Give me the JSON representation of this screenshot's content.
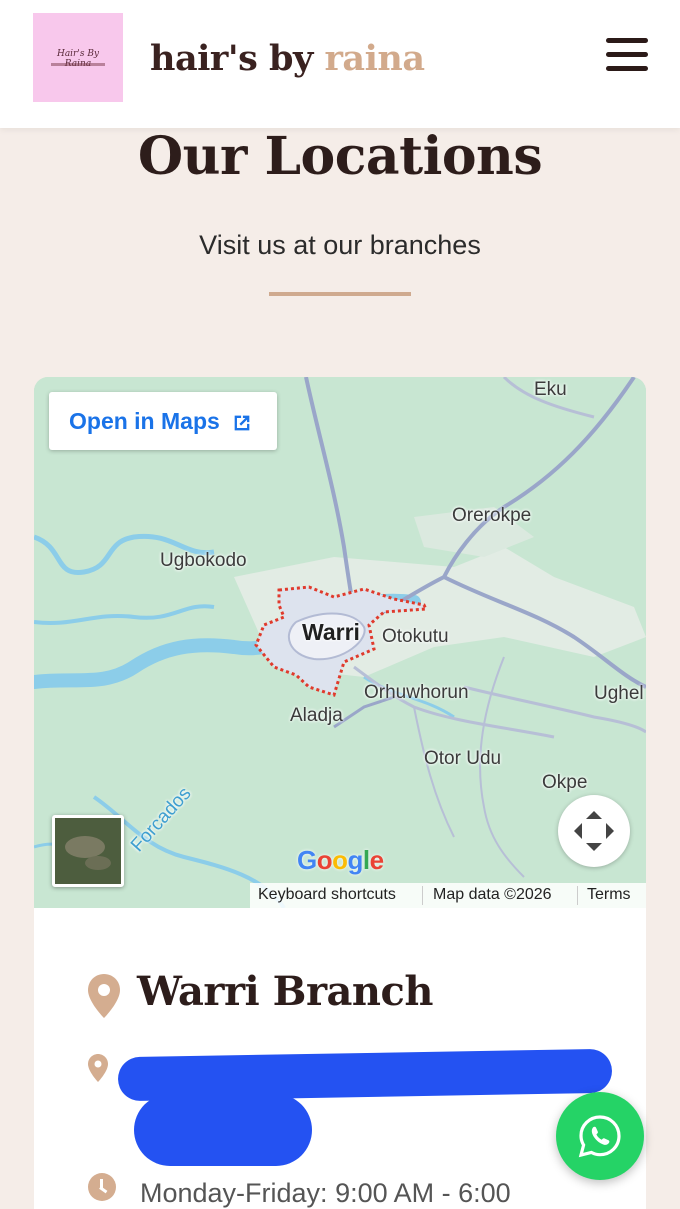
{
  "header": {
    "logo_text": "Hair's By Raina",
    "brand_primary": "hair's by",
    "brand_accent": "raina",
    "menu_icon": "hamburger-menu-icon"
  },
  "page": {
    "title": "Our Locations",
    "subtitle": "Visit us at our branches"
  },
  "map": {
    "open_in_maps_label": "Open in Maps",
    "open_in_maps_icon": "external-link-icon",
    "places": [
      "Eku",
      "Orerokpe",
      "Ugbokodo",
      "Warri",
      "Otokutu",
      "Orhuwhorun",
      "Ughel",
      "Aladja",
      "Otor Udu",
      "Okpe",
      "Forcados"
    ],
    "logo": "Google",
    "attribution": {
      "keyboard_shortcuts": "Keyboard shortcuts",
      "map_data": "Map data ©2026",
      "terms": "Terms"
    },
    "layer_toggle_icon": "satellite-layer-icon",
    "recenter_icon": "fullscreen-expand-icon"
  },
  "branch": {
    "name": "Warri Branch",
    "name_icon": "location-pin-icon",
    "address_icon": "location-pin-icon",
    "hours_icon": "clock-icon",
    "hours": "Monday-Friday: 9:00 AM - 6:00"
  },
  "floating": {
    "whatsapp_icon": "whatsapp-icon"
  },
  "colors": {
    "accent": "#d2aa8c",
    "heading": "#2d1d1b",
    "page_bg": "#f5ede8",
    "whatsapp": "#25d366",
    "link": "#1a73e8"
  }
}
